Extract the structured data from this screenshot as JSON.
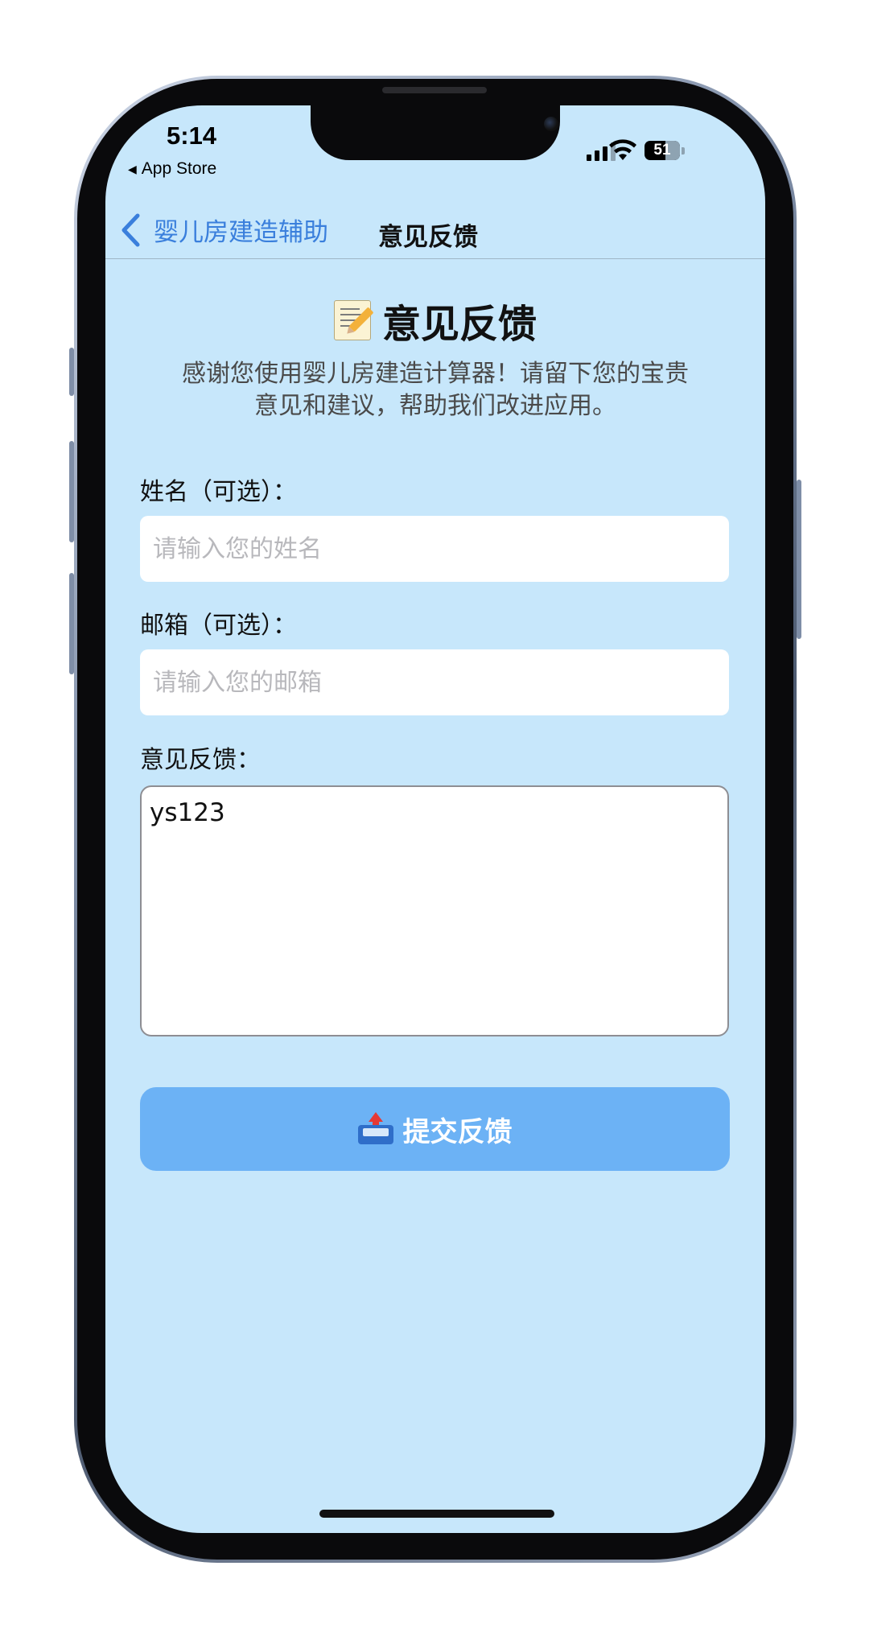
{
  "status_bar": {
    "time": "5:14",
    "back_app": "App Store",
    "battery": "51"
  },
  "nav": {
    "back_label": "婴儿房建造辅助",
    "title": "意见反馈"
  },
  "page": {
    "title": "意见反馈",
    "subtitle_line1": "感谢您使用婴儿房建造计算器！请留下您的宝贵",
    "subtitle_line2": "意见和建议，帮助我们改进应用。"
  },
  "form": {
    "name_label": "姓名（可选）：",
    "name_placeholder": "请输入您的姓名",
    "name_value": "",
    "email_label": "邮箱（可选）：",
    "email_placeholder": "请输入您的邮箱",
    "email_value": "",
    "feedback_label": "意见反馈：",
    "feedback_value": "ys123",
    "submit_label": "提交反馈"
  },
  "icons": {
    "title_icon": "memo-icon",
    "submit_icon": "outbox-tray-icon",
    "back_icon": "chevron-left-icon"
  },
  "colors": {
    "background": "#c7e7fb",
    "accent": "#3a7fdc",
    "button": "#6cb2f5"
  }
}
